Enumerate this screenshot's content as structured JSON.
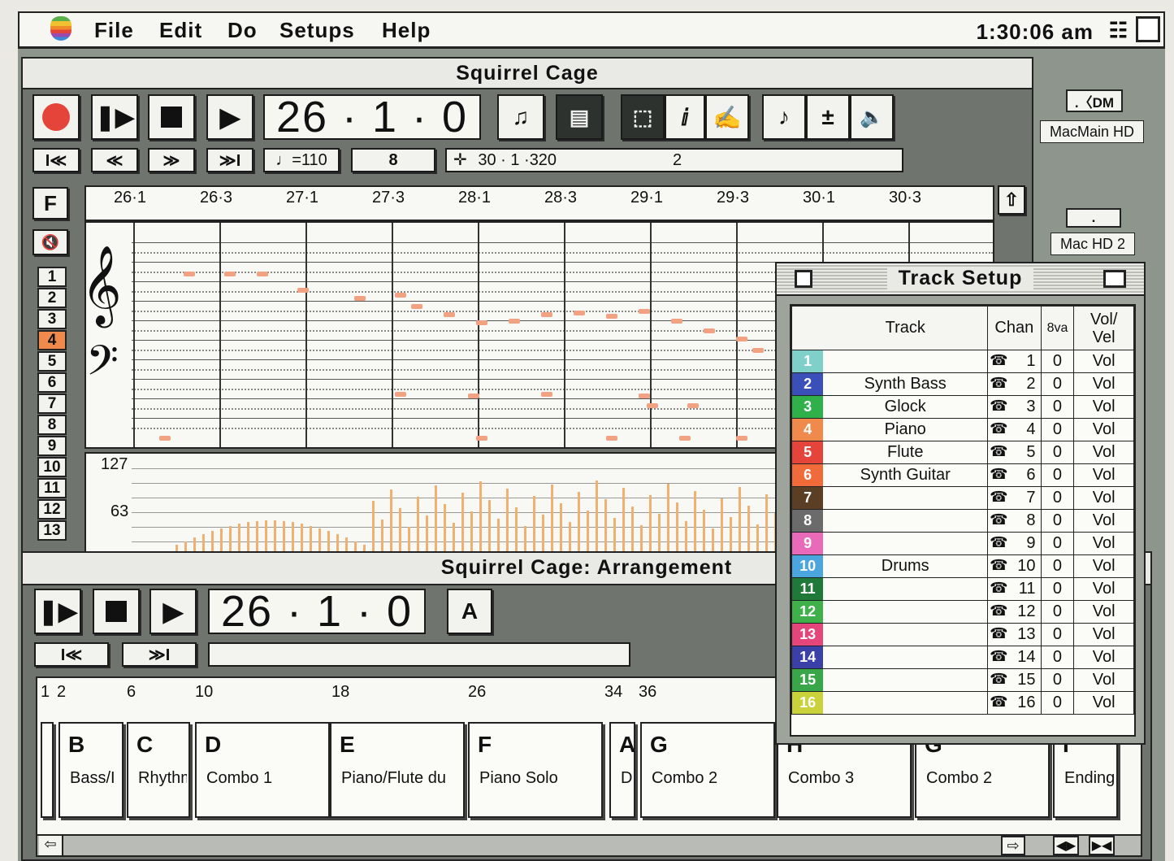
{
  "menubar": {
    "items": [
      "File",
      "Edit",
      "Do",
      "Setups",
      "Help"
    ],
    "clock": "1:30:06 am"
  },
  "desktop": {
    "disk1": "MacMain HD",
    "disk2": "Mac HD 2"
  },
  "main_window": {
    "title": "Squirrel Cage",
    "counter": "26 · 1 · 0",
    "tempo": "♩=110",
    "bars_field": "8",
    "position": "30 · 1 ·320",
    "position_extra": "2",
    "ruler": [
      "26·1",
      "26·3",
      "27·1",
      "27·3",
      "28·1",
      "28·3",
      "29·1",
      "29·3",
      "30·1",
      "30·3"
    ],
    "track_numbers": [
      "1",
      "2",
      "3",
      "4",
      "5",
      "6",
      "7",
      "8",
      "9",
      "10",
      "11",
      "12",
      "13"
    ],
    "selected_track": "4",
    "f_button": "F",
    "vel_max": "127",
    "vel_mid": "63"
  },
  "arrangement": {
    "title": "Squirrel Cage: Arrangement",
    "counter": "26 · 1 · 0",
    "mode": "A",
    "ruler": [
      "1",
      "2",
      "6",
      "10",
      "18",
      "26",
      "34",
      "36"
    ],
    "segments": [
      {
        "letter": "B",
        "name": "Bass/I"
      },
      {
        "letter": "C",
        "name": "Rhythm"
      },
      {
        "letter": "D",
        "name": "Combo 1"
      },
      {
        "letter": "E",
        "name": "Piano/Flute du"
      },
      {
        "letter": "F",
        "name": "Piano Solo"
      },
      {
        "letter": "A",
        "name": "Dr"
      },
      {
        "letter": "G",
        "name": "Combo 2"
      },
      {
        "letter": "H",
        "name": "Combo 3"
      },
      {
        "letter": "G",
        "name": "Combo 2"
      },
      {
        "letter": "I",
        "name": "Ending"
      }
    ]
  },
  "track_setup": {
    "title": "Track Setup",
    "headers": {
      "track": "Track",
      "chan": "Chan",
      "octave": "8va",
      "vol": "Vol/",
      "vel": "Vel"
    },
    "rows": [
      {
        "n": "1",
        "name": "",
        "chan": "1",
        "oct": "0",
        "vol": "Vol",
        "color": "#7fd0c8"
      },
      {
        "n": "2",
        "name": "Synth Bass",
        "chan": "2",
        "oct": "0",
        "vol": "Vol",
        "color": "#3a4fb8"
      },
      {
        "n": "3",
        "name": "Glock",
        "chan": "3",
        "oct": "0",
        "vol": "Vol",
        "color": "#2fb04a"
      },
      {
        "n": "4",
        "name": "Piano",
        "chan": "4",
        "oct": "0",
        "vol": "Vol",
        "color": "#f08a4c"
      },
      {
        "n": "5",
        "name": "Flute",
        "chan": "5",
        "oct": "0",
        "vol": "Vol",
        "color": "#e5443a"
      },
      {
        "n": "6",
        "name": "Synth Guitar",
        "chan": "6",
        "oct": "0",
        "vol": "Vol",
        "color": "#f06a3a"
      },
      {
        "n": "7",
        "name": "",
        "chan": "7",
        "oct": "0",
        "vol": "Vol",
        "color": "#5a3f24"
      },
      {
        "n": "8",
        "name": "",
        "chan": "8",
        "oct": "0",
        "vol": "Vol",
        "color": "#6b6b6b"
      },
      {
        "n": "9",
        "name": "",
        "chan": "9",
        "oct": "0",
        "vol": "Vol",
        "color": "#e86ab8"
      },
      {
        "n": "10",
        "name": "Drums",
        "chan": "10",
        "oct": "0",
        "vol": "Vol",
        "color": "#4ba6e0"
      },
      {
        "n": "11",
        "name": "",
        "chan": "11",
        "oct": "0",
        "vol": "Vol",
        "color": "#1f7a3a"
      },
      {
        "n": "12",
        "name": "",
        "chan": "12",
        "oct": "0",
        "vol": "Vol",
        "color": "#3fb04a"
      },
      {
        "n": "13",
        "name": "",
        "chan": "13",
        "oct": "0",
        "vol": "Vol",
        "color": "#e4457a"
      },
      {
        "n": "14",
        "name": "",
        "chan": "14",
        "oct": "0",
        "vol": "Vol",
        "color": "#3b3fa8"
      },
      {
        "n": "15",
        "name": "",
        "chan": "15",
        "oct": "0",
        "vol": "Vol",
        "color": "#3aa64a"
      },
      {
        "n": "16",
        "name": "",
        "chan": "16",
        "oct": "0",
        "vol": "Vol",
        "color": "#c9d23a"
      }
    ]
  }
}
